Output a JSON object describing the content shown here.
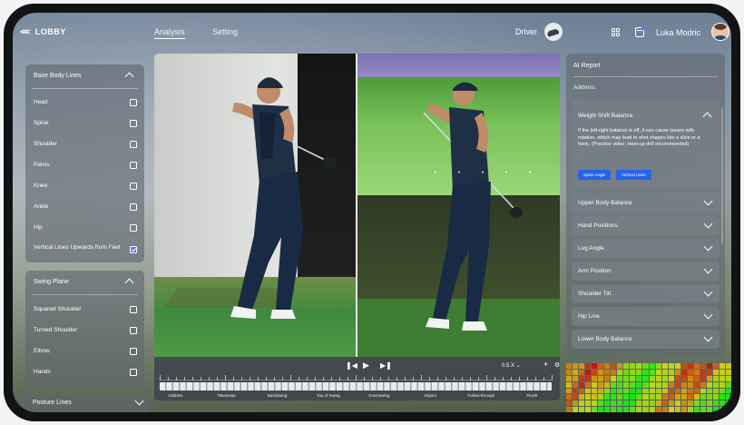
{
  "topbar": {
    "lobby_label": "LOBBY",
    "tabs": [
      {
        "label": "Analysis",
        "active": true
      },
      {
        "label": "Setting",
        "active": false
      }
    ],
    "club_label": "Driver",
    "user_name": "Luka Modric"
  },
  "base_body_lines": {
    "title": "Base Body Lines",
    "items": [
      {
        "label": "Head",
        "checked": false
      },
      {
        "label": "Spine",
        "checked": false
      },
      {
        "label": "Shoulder",
        "checked": false
      },
      {
        "label": "Pelvis",
        "checked": false
      },
      {
        "label": "Knee",
        "checked": false
      },
      {
        "label": "Ankle",
        "checked": false
      },
      {
        "label": "Hip",
        "checked": false
      },
      {
        "label": "Vertical Lines Upwards from Feet",
        "checked": true
      }
    ]
  },
  "swing_plane": {
    "title": "Swing Plane",
    "items": [
      {
        "label": "Squared Shoulder",
        "checked": false
      },
      {
        "label": "Turned Shoulder",
        "checked": false
      },
      {
        "label": "Elbow",
        "checked": false
      },
      {
        "label": "Hands",
        "checked": false
      }
    ]
  },
  "posture_lines": {
    "title": "Posture Lines"
  },
  "player": {
    "speed": "0.5 X",
    "phases": [
      "Address",
      "Takeaway",
      "Backswing",
      "Top of Swing",
      "Downswing",
      "Impact",
      "Follow-through",
      "Finish"
    ]
  },
  "ai_report": {
    "title": "AI Report",
    "subtitle": "Address",
    "expanded": {
      "title": "Weight Shift Balance",
      "text": "If the left-right balance is off, it can cause issues with rotation, which may lead to shot shapes like a slice or a hook. (Practice video: Heel-up drill recommended)",
      "buttons": [
        "Spine Angle",
        "Vertical Lines"
      ]
    },
    "sections": [
      "Upper Body Balance",
      "Hand Positions",
      "Leg Angle",
      "Arm Position",
      "Shoulder Tilt",
      "Hip Line",
      "Lower Body Balance"
    ]
  },
  "colors": {
    "accent": "#2563eb",
    "panel": "#606870"
  }
}
